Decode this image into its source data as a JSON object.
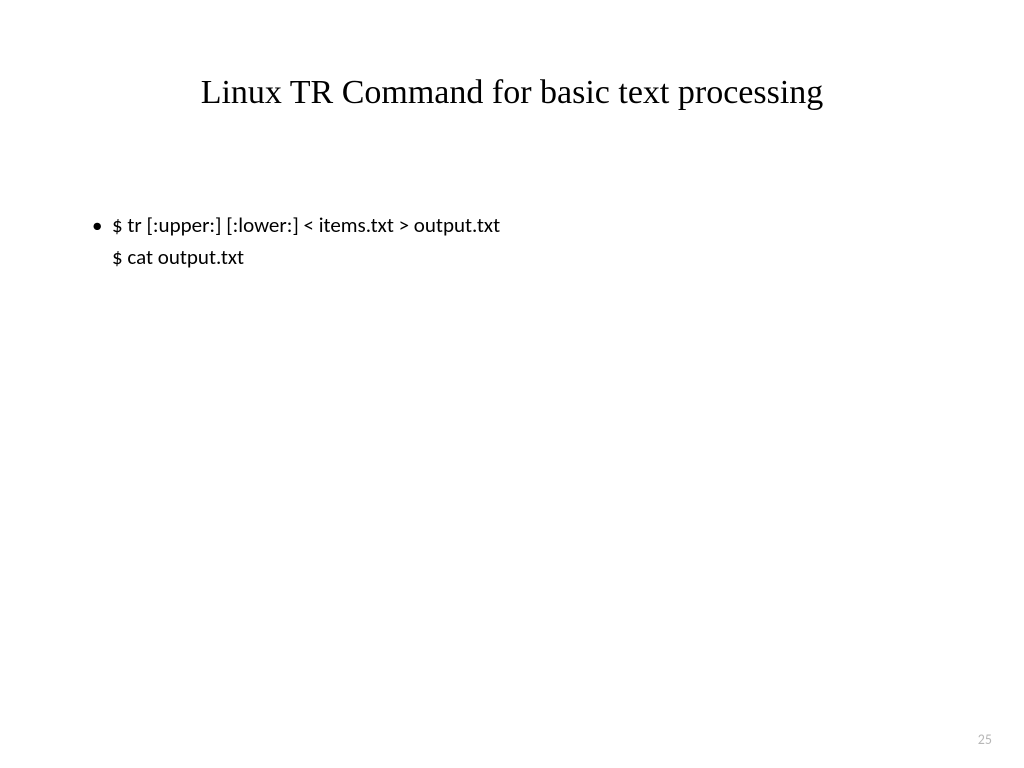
{
  "slide": {
    "title": "Linux TR Command for basic text processing",
    "bullet": {
      "line1": "$ tr [:upper:] [:lower:] < items.txt > output.txt",
      "line2": "$ cat output.txt"
    },
    "pageNumber": "25"
  }
}
